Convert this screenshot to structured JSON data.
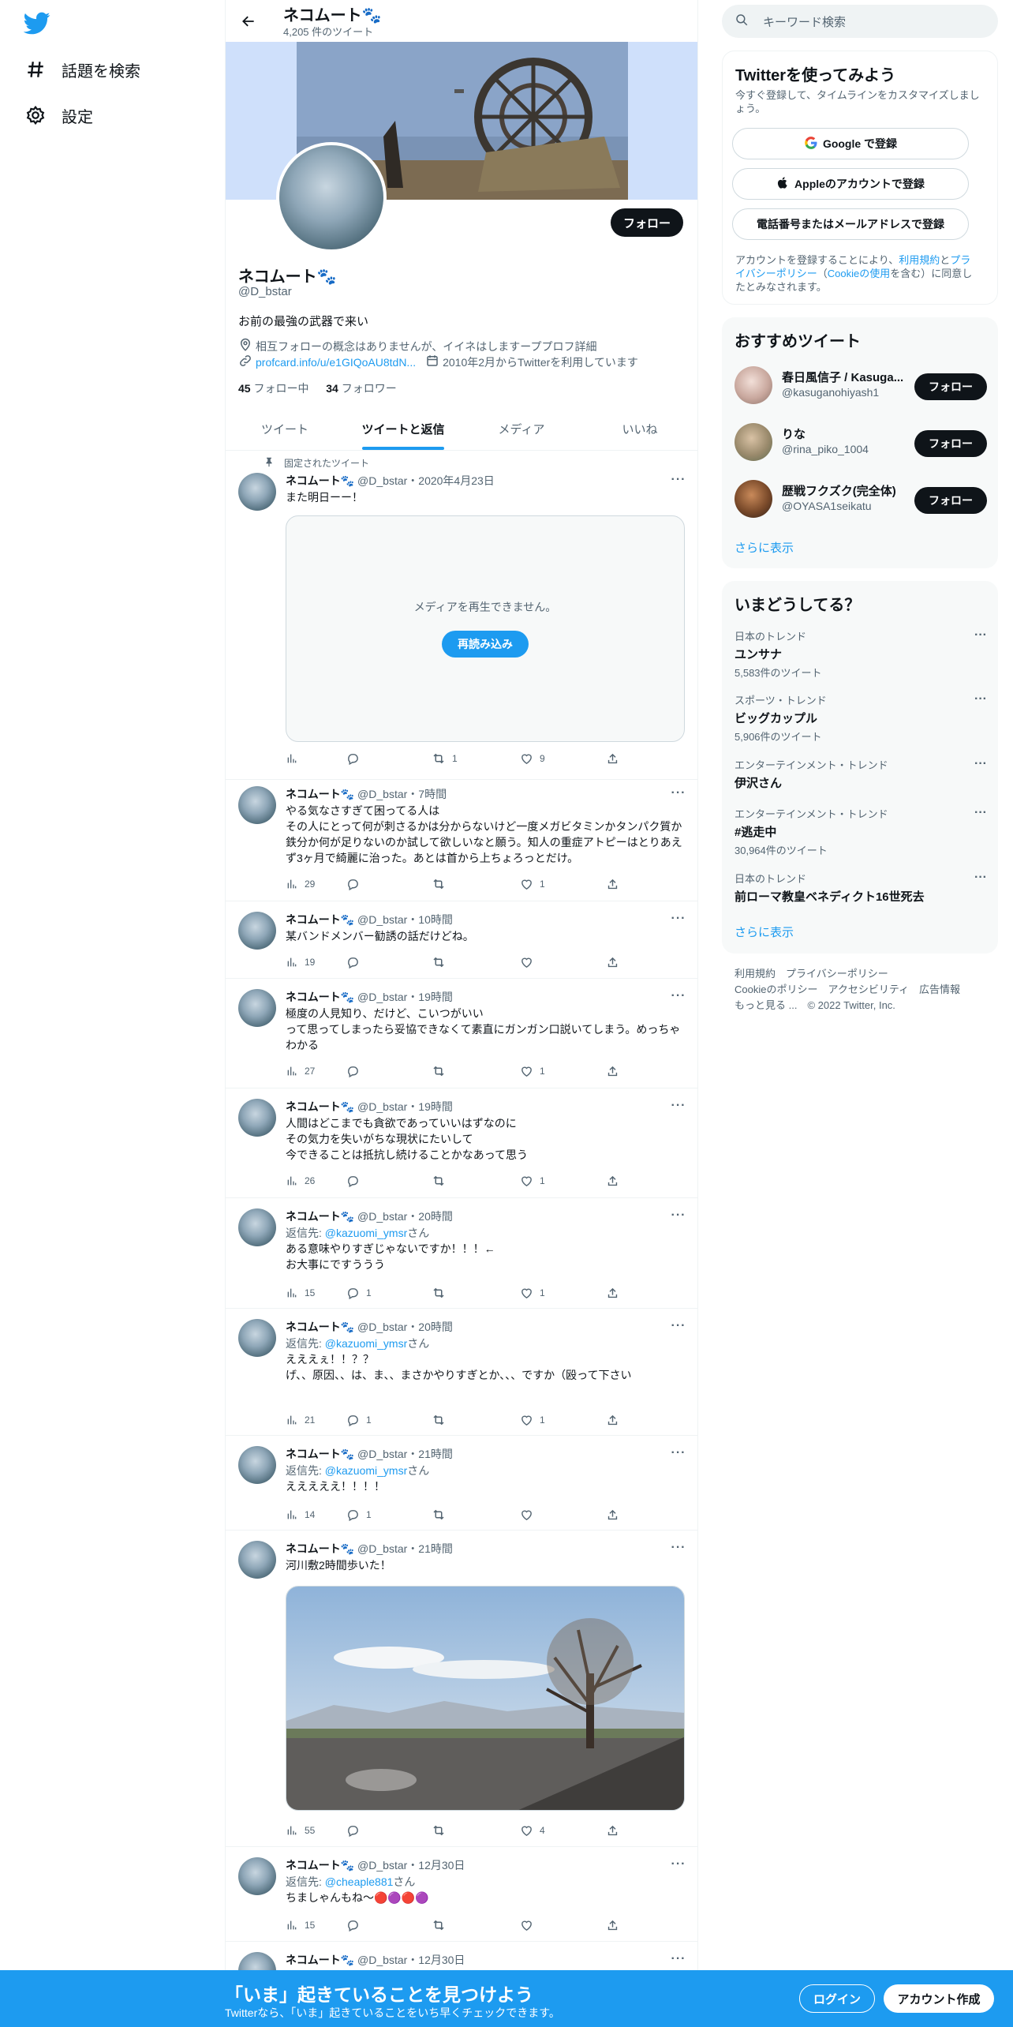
{
  "nav": {
    "explore_label": "話題を検索",
    "settings_label": "設定"
  },
  "header": {
    "name": "ネコムート🐾",
    "tweet_count": "4,205 件のツイート"
  },
  "profile": {
    "follow_label": "フォロー",
    "name": "ネコムート🐾",
    "handle": "@D_bstar",
    "bio": "お前の最強の武器で来い",
    "location": "相互フォローの概念はありませんが、イイネはしますーププロフ詳細",
    "url": "profcard.info/u/e1GIQoAU8tdN...",
    "joined": "2010年2月からTwitterを利用しています",
    "following_count": "45",
    "following_label": "フォロー中",
    "followers_count": "34",
    "followers_label": "フォロワー"
  },
  "tabs": [
    {
      "label": "ツイート"
    },
    {
      "label": "ツイートと返信"
    },
    {
      "label": "メディア"
    },
    {
      "label": "いいね"
    }
  ],
  "pinned_label": "固定されたツイート",
  "tweets": [
    {
      "name": "ネコムート🐾",
      "meta": "@D_bstar・2020年4月23日",
      "text": "また明日ーー！",
      "media_message": "メディアを再生できません。",
      "reload_label": "再読み込み",
      "views": "",
      "replies": "",
      "retweets": "1",
      "likes": "9"
    },
    {
      "name": "ネコムート🐾",
      "meta": "@D_bstar・7時間",
      "text": "やる気なさすぎて困ってる人は\nその人にとって何が刺さるかは分からないけど一度メガビタミンかタンパク質か鉄分か何が足りないのか試して欲しいなと願う。知人の重症アトピーはとりあえず3ヶ月で綺麗に治った。あとは首から上ちょろっとだけ。",
      "views": "29",
      "replies": "",
      "retweets": "",
      "likes": "1"
    },
    {
      "name": "ネコムート🐾",
      "meta": "@D_bstar・10時間",
      "text": "某バンドメンバー勧誘の話だけどね。",
      "views": "19",
      "replies": "",
      "retweets": "",
      "likes": ""
    },
    {
      "name": "ネコムート🐾",
      "meta": "@D_bstar・19時間",
      "text": "極度の人見知り、だけど、こいつがいい\nって思ってしまったら妥協できなくて素直にガンガン口説いてしまう。めっちゃわかる",
      "views": "27",
      "replies": "",
      "retweets": "",
      "likes": "1"
    },
    {
      "name": "ネコムート🐾",
      "meta": "@D_bstar・19時間",
      "text": "人間はどこまでも貪欲であっていいはずなのに\nその気力を失いがちな現状にたいして\n今できることは抵抗し続けることかなあって思う",
      "views": "26",
      "replies": "",
      "retweets": "",
      "likes": "1"
    },
    {
      "name": "ネコムート🐾",
      "meta": "@D_bstar・20時間",
      "reply_prefix": "返信先: ",
      "reply_to": "@kazuomi_ymsr",
      "reply_suffix": "さん",
      "text": "ある意味やりすぎじゃないですか！！！←\nお大事にですううう",
      "views": "15",
      "replies": "1",
      "retweets": "",
      "likes": "1"
    },
    {
      "name": "ネコムート🐾",
      "meta": "@D_bstar・20時間",
      "reply_prefix": "返信先: ",
      "reply_to": "@kazuomi_ymsr",
      "reply_suffix": "さん",
      "text": "えええぇ！！？？\nげ、、原因、、は、ま、、まさかやりすぎとか、、、ですか（殴って下さい",
      "views": "21",
      "replies": "1",
      "retweets": "",
      "likes": "1"
    },
    {
      "name": "ネコムート🐾",
      "meta": "@D_bstar・21時間",
      "reply_prefix": "返信先: ",
      "reply_to": "@kazuomi_ymsr",
      "reply_suffix": "さん",
      "text": "えええええ！！！！",
      "views": "14",
      "replies": "1",
      "retweets": "",
      "likes": ""
    },
    {
      "name": "ネコムート🐾",
      "meta": "@D_bstar・21時間",
      "text": "河川敷2時間歩いた！",
      "views": "55",
      "replies": "",
      "retweets": "",
      "likes": "4"
    },
    {
      "name": "ネコムート🐾",
      "meta": "@D_bstar・12月30日",
      "reply_prefix": "返信先: ",
      "reply_to": "@cheaple881",
      "reply_suffix": "さん",
      "text": "ちましゃんもね〜🔴🟣🔴🟣",
      "views": "15",
      "replies": "",
      "retweets": "",
      "likes": ""
    },
    {
      "name": "ネコムート🐾",
      "meta": "@D_bstar・12月30日",
      "text": "",
      "views": "",
      "replies": "",
      "retweets": "",
      "likes": ""
    }
  ],
  "search": {
    "placeholder": "キーワード検索"
  },
  "signup_card": {
    "title": "Twitterを使ってみよう",
    "subtitle": "今すぐ登録して、タイムラインをカスタマイズしましょう。",
    "google_label": "Google で登録",
    "apple_label": "Appleのアカウントで登録",
    "phone_label": "電話番号またはメールアドレスで登録",
    "terms_prefix": "アカウントを登録することにより、",
    "terms_link": "利用規約",
    "terms_and": "と",
    "privacy_link": "プライバシーポリシー",
    "cookie_open": "（",
    "cookie_link": "Cookieの使用",
    "terms_suffix": "を含む）に同意したとみなされます。"
  },
  "recommended": {
    "title": "おすすめツイート",
    "users": [
      {
        "name": "春日風信子 / Kasuga...",
        "handle": "@kasuganohiyash1",
        "follow_label": "フォロー"
      },
      {
        "name": "りな",
        "handle": "@rina_piko_1004",
        "follow_label": "フォロー"
      },
      {
        "name": "歴戦フクズク(完全体)",
        "handle": "@OYASA1seikatu",
        "follow_label": "フォロー"
      }
    ],
    "more_label": "さらに表示"
  },
  "trends": {
    "title": "いまどうしてる？",
    "items": [
      {
        "category": "日本のトレンド",
        "name": "ユンサナ",
        "count": "5,583件のツイート"
      },
      {
        "category": "スポーツ・トレンド",
        "name": "ビッグカップル",
        "count": "5,906件のツイート"
      },
      {
        "category": "エンターテインメント・トレンド",
        "name": "伊沢さん",
        "count": ""
      },
      {
        "category": "エンターテインメント・トレンド",
        "name": "#逃走中",
        "count": "30,964件のツイート"
      },
      {
        "category": "日本のトレンド",
        "name": "前ローマ教皇ベネディクト16世死去",
        "count": ""
      }
    ],
    "more_label": "さらに表示"
  },
  "footer": {
    "line1": "利用規約　プライバシーポリシー",
    "line2": "Cookieのポリシー　アクセシビリティ　広告情報",
    "line3": "もっと見る ...　© 2022 Twitter, Inc."
  },
  "bottom_bar": {
    "title": "「いま」起きていることを見つけよう",
    "subtitle": "Twitterなら、「いま」起きていることをいち早くチェックできます。",
    "login_label": "ログイン",
    "signup_label": "アカウント作成"
  }
}
